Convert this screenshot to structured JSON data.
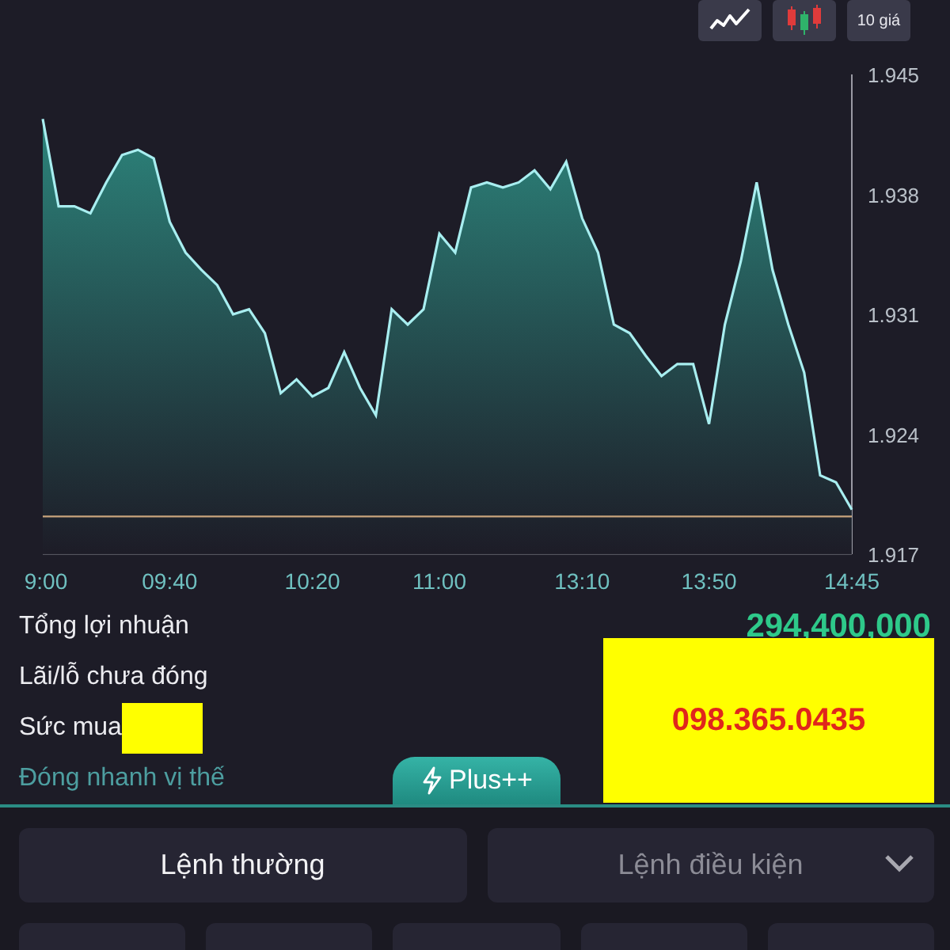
{
  "toolbar": {
    "buttons": [
      {
        "kind": "line"
      },
      {
        "kind": "candles"
      },
      {
        "kind": "text",
        "label": "10 giá"
      }
    ]
  },
  "chart": {
    "chart_data": {
      "type": "area",
      "ylim": [
        1.917,
        1.945
      ],
      "categories": [
        "9:00",
        null,
        null,
        null,
        null,
        null,
        null,
        null,
        "09:40",
        null,
        null,
        null,
        null,
        null,
        null,
        null,
        null,
        "10:20",
        null,
        null,
        null,
        null,
        null,
        null,
        null,
        "11:00",
        null,
        null,
        null,
        null,
        null,
        null,
        null,
        null,
        "13:10",
        null,
        null,
        null,
        null,
        null,
        null,
        null,
        "13:50",
        null,
        null,
        null,
        null,
        null,
        null,
        null,
        null,
        "14:45"
      ],
      "series": [
        {
          "color": "#a8eef0",
          "values": [
            1.9424,
            1.9373,
            1.9373,
            1.9369,
            1.9387,
            1.9403,
            1.9406,
            1.9401,
            1.9364,
            1.9346,
            1.9336,
            1.9327,
            1.931,
            1.9313,
            1.9299,
            1.9264,
            1.9272,
            1.9262,
            1.9267,
            1.9288,
            1.9267,
            1.9251,
            1.9313,
            1.9304,
            1.9313,
            1.9357,
            1.9346,
            1.9384,
            1.9387,
            1.9384,
            1.9387,
            1.9394,
            1.9383,
            1.9399,
            1.9366,
            1.9346,
            1.9304,
            1.9299,
            1.9286,
            1.9274,
            1.9281,
            1.9281,
            1.9246,
            1.9304,
            1.9341,
            1.9387,
            1.9336,
            1.9304,
            1.9276,
            1.9216,
            1.9212,
            1.9196
          ]
        },
        {
          "type": "line",
          "color": "#c9a47c",
          "values": [
            1.9192,
            1.9192,
            1.9192,
            1.9192,
            1.9192,
            1.9192,
            1.9192,
            1.9192,
            1.9192,
            1.9192,
            1.9192,
            1.9192,
            1.9192,
            1.9192,
            1.9192,
            1.9192,
            1.9192,
            1.9192,
            1.9192,
            1.9192,
            1.9192,
            1.9192,
            1.9192,
            1.9192,
            1.9192,
            1.9192,
            1.9192,
            1.9192,
            1.9192,
            1.9192,
            1.9192,
            1.9192,
            1.9192,
            1.9192,
            1.9192,
            1.9192,
            1.9192,
            1.9192,
            1.9192,
            1.9192,
            1.9192,
            1.9192,
            1.9192,
            1.9192,
            1.9192,
            1.9192,
            1.9192,
            1.9192,
            1.9192,
            1.9192,
            1.9192,
            1.9192
          ]
        }
      ],
      "yticks": [
        {
          "value": 1.917,
          "label": "1.917"
        },
        {
          "value": 1.924,
          "label": "1.924"
        },
        {
          "value": 1.931,
          "label": "1.931"
        },
        {
          "value": 1.938,
          "label": "1.938"
        },
        {
          "value": 1.945,
          "label": "1.945"
        }
      ]
    }
  },
  "info": {
    "total_profit": {
      "label": "Tổng lợi nhuận",
      "value": "294,400,000"
    },
    "unrealized": {
      "label": "Lãi/lỗ chưa đóng"
    },
    "buying_power": {
      "label": "Sức mua",
      "redacted": true
    },
    "quick_close": {
      "label": "Đóng nhanh vị thế"
    },
    "contact_overlay": {
      "text": "098.365.0435"
    },
    "plus_tab": {
      "label": "Plus++"
    }
  },
  "order_tabs": [
    {
      "label": "Lệnh thường",
      "selected": true,
      "kind": "plain"
    },
    {
      "label": "Lệnh điều kiện",
      "selected": false,
      "kind": "dropdown"
    }
  ]
}
